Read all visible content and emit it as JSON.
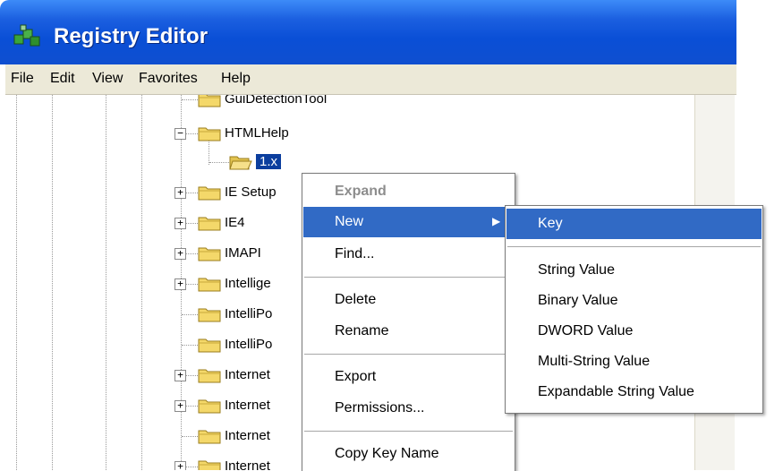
{
  "window": {
    "title": "Registry Editor"
  },
  "menubar": {
    "items": [
      "File",
      "Edit",
      "View",
      "Favorites",
      "Help"
    ]
  },
  "tree": {
    "nodes": [
      {
        "label": "GuiDetectionTool",
        "expander": ""
      },
      {
        "label": "HTMLHelp",
        "expander": "−"
      },
      {
        "label": "1.x",
        "expander": "",
        "selected": true
      },
      {
        "label": "IE Setup",
        "expander": "+"
      },
      {
        "label": "IE4",
        "expander": "+"
      },
      {
        "label": "IMAPI",
        "expander": "+"
      },
      {
        "label": "Intellige",
        "expander": "+"
      },
      {
        "label": "IntelliPo",
        "expander": ""
      },
      {
        "label": "IntelliPo",
        "expander": ""
      },
      {
        "label": "Internet",
        "expander": "+"
      },
      {
        "label": "Internet",
        "expander": "+"
      },
      {
        "label": "Internet",
        "expander": ""
      },
      {
        "label": "Internet",
        "expander": "+"
      }
    ]
  },
  "context_menu": {
    "expand": "Expand",
    "new": "New",
    "find": "Find...",
    "delete": "Delete",
    "rename": "Rename",
    "export": "Export",
    "permissions": "Permissions...",
    "copy_key_name": "Copy Key Name"
  },
  "submenu": {
    "key": "Key",
    "string_value": "String Value",
    "binary_value": "Binary Value",
    "dword_value": "DWORD Value",
    "multi_string_value": "Multi-String Value",
    "expandable_string_value": "Expandable String Value"
  },
  "colors": {
    "title_bar": "#0a4fd6",
    "selection": "#316ac5",
    "menu_bar": "#ece9d8",
    "folder": "#f4d86a"
  }
}
